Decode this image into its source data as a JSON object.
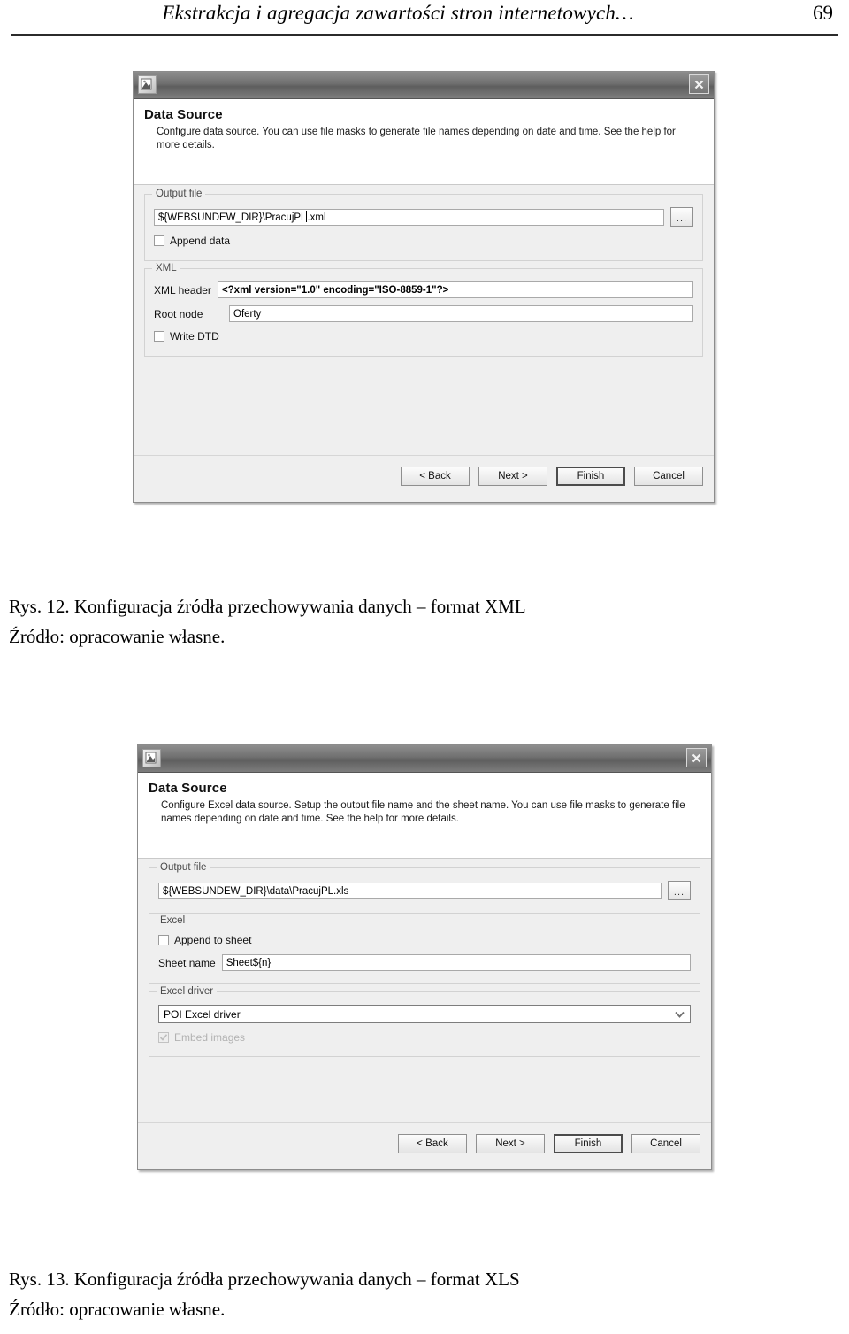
{
  "page": {
    "running_head": "Ekstrakcja i agregacja zawartości stron internetowych…",
    "page_number": "69"
  },
  "dialog_xml": {
    "title_icon": "app-window-icon",
    "close_icon": "close-icon",
    "banner": {
      "title": "Data Source",
      "description": "Configure data source. You can use file masks to generate file names depending on date and time. See the help for more details."
    },
    "groups": {
      "output_file": {
        "legend": "Output file",
        "path_value": "${WEBSUNDEW_DIR}\\PracujPL.xml",
        "browse_label": "...",
        "append_data_label": "Append data",
        "append_data_checked": false
      },
      "xml": {
        "legend": "XML",
        "header_label": "XML header",
        "header_value": "<?xml version=\"1.0\" encoding=\"ISO-8859-1\"?>",
        "root_node_label": "Root node",
        "root_node_value": "Oferty",
        "write_dtd_label": "Write DTD",
        "write_dtd_checked": false
      }
    },
    "buttons": {
      "back": "< Back",
      "next": "Next >",
      "finish": "Finish",
      "cancel": "Cancel"
    }
  },
  "caption_12": {
    "line1": "Rys. 12.  Konfiguracja źródła przechowywania danych – format XML",
    "line2": "Źródło:  opracowanie własne."
  },
  "dialog_xls": {
    "title_icon": "app-window-icon",
    "close_icon": "close-icon",
    "banner": {
      "title": "Data Source",
      "description": "Configure Excel data source. Setup the output file name and the sheet name. You can use file masks to generate file names depending on date and time. See the help for more details."
    },
    "groups": {
      "output_file": {
        "legend": "Output file",
        "path_value": "${WEBSUNDEW_DIR}\\data\\PracujPL.xls",
        "browse_label": "..."
      },
      "excel": {
        "legend": "Excel",
        "append_to_sheet_label": "Append to sheet",
        "append_to_sheet_checked": false,
        "sheet_name_label": "Sheet name",
        "sheet_name_value": "Sheet${n}"
      },
      "excel_driver": {
        "legend": "Excel driver",
        "selected_driver": "POI Excel driver",
        "embed_images_label": "Embed images",
        "embed_images_checked": true,
        "embed_images_disabled": true
      }
    },
    "buttons": {
      "back": "< Back",
      "next": "Next >",
      "finish": "Finish",
      "cancel": "Cancel"
    }
  },
  "caption_13": {
    "line1": "Rys. 13.  Konfiguracja źródła przechowywania danych – format XLS",
    "line2": "Źródło:  opracowanie własne."
  }
}
